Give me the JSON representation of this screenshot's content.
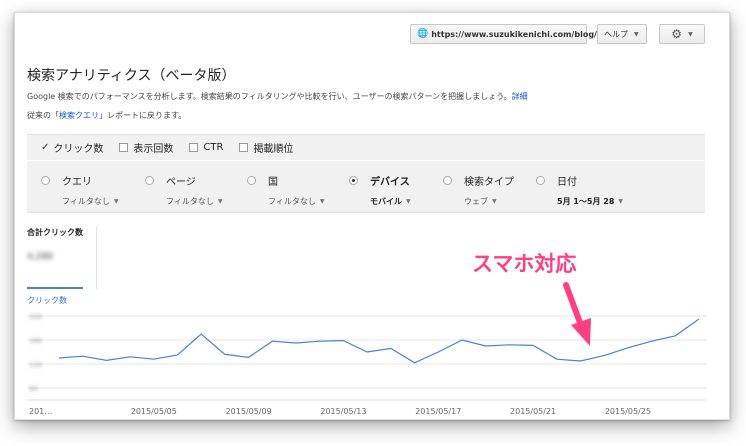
{
  "topbar": {
    "site_url": "https://www.suzukikenichi.com/blog/",
    "help_label": "ヘルプ",
    "globe_icon": "globe-icon",
    "gear_icon": "gear-icon"
  },
  "page": {
    "title": "検索アナリティクス（ベータ版）",
    "description": "Google 検索でのパフォーマンスを分析します。検索結果のフィルタリングや比較を行い、ユーザーの検索パターンを把握しましょう。",
    "description_link": "詳細",
    "prev_prefix": "従来の「",
    "prev_link": "検索クエリ",
    "prev_suffix": "」レポートに戻ります。"
  },
  "metrics": [
    {
      "label": "クリック数",
      "checked": true
    },
    {
      "label": "表示回数",
      "checked": false
    },
    {
      "label": "CTR",
      "checked": false
    },
    {
      "label": "掲載順位",
      "checked": false
    }
  ],
  "dimensions": [
    {
      "label": "クエリ",
      "filter": "フィルタなし",
      "selected": false
    },
    {
      "label": "ページ",
      "filter": "フィルタなし",
      "selected": false
    },
    {
      "label": "国",
      "filter": "フィルタなし",
      "selected": false
    },
    {
      "label": "デバイス",
      "filter": "モバイル",
      "selected": true
    },
    {
      "label": "検索タイプ",
      "filter": "ウェブ",
      "selected": false
    },
    {
      "label": "日付",
      "filter": "5月 1～5月 28",
      "selected": false
    }
  ],
  "total": {
    "label": "合計クリック数",
    "value": "4,288"
  },
  "series_label": "クリック数",
  "annotation": "スマホ対応",
  "accent_color": "#4a7ee0",
  "annotation_color": "#ff3f84",
  "chart_data": {
    "type": "line",
    "series": [
      {
        "name": "クリック数",
        "values": [
          130,
          133,
          126,
          132,
          128,
          135,
          170,
          136,
          131,
          158,
          155,
          158,
          159,
          140,
          146,
          122,
          140,
          160,
          150,
          152,
          151,
          128,
          125,
          134,
          147,
          158,
          167,
          195
        ]
      }
    ],
    "x": [
      "2015/05/01",
      "2015/05/02",
      "2015/05/03",
      "2015/05/04",
      "2015/05/05",
      "2015/05/06",
      "2015/05/07",
      "2015/05/08",
      "2015/05/09",
      "2015/05/10",
      "2015/05/11",
      "2015/05/12",
      "2015/05/13",
      "2015/05/14",
      "2015/05/15",
      "2015/05/16",
      "2015/05/17",
      "2015/05/18",
      "2015/05/19",
      "2015/05/20",
      "2015/05/21",
      "2015/05/22",
      "2015/05/23",
      "2015/05/24",
      "2015/05/25",
      "2015/05/26",
      "2015/05/27",
      "2015/05/28"
    ],
    "xticks": [
      "201…",
      "2015/05/05",
      "2015/05/09",
      "2015/05/13",
      "2015/05/17",
      "2015/05/21",
      "2015/05/25"
    ],
    "yticks": [
      200,
      160,
      120,
      80
    ],
    "ylim": [
      60,
      200
    ],
    "grid": true
  }
}
